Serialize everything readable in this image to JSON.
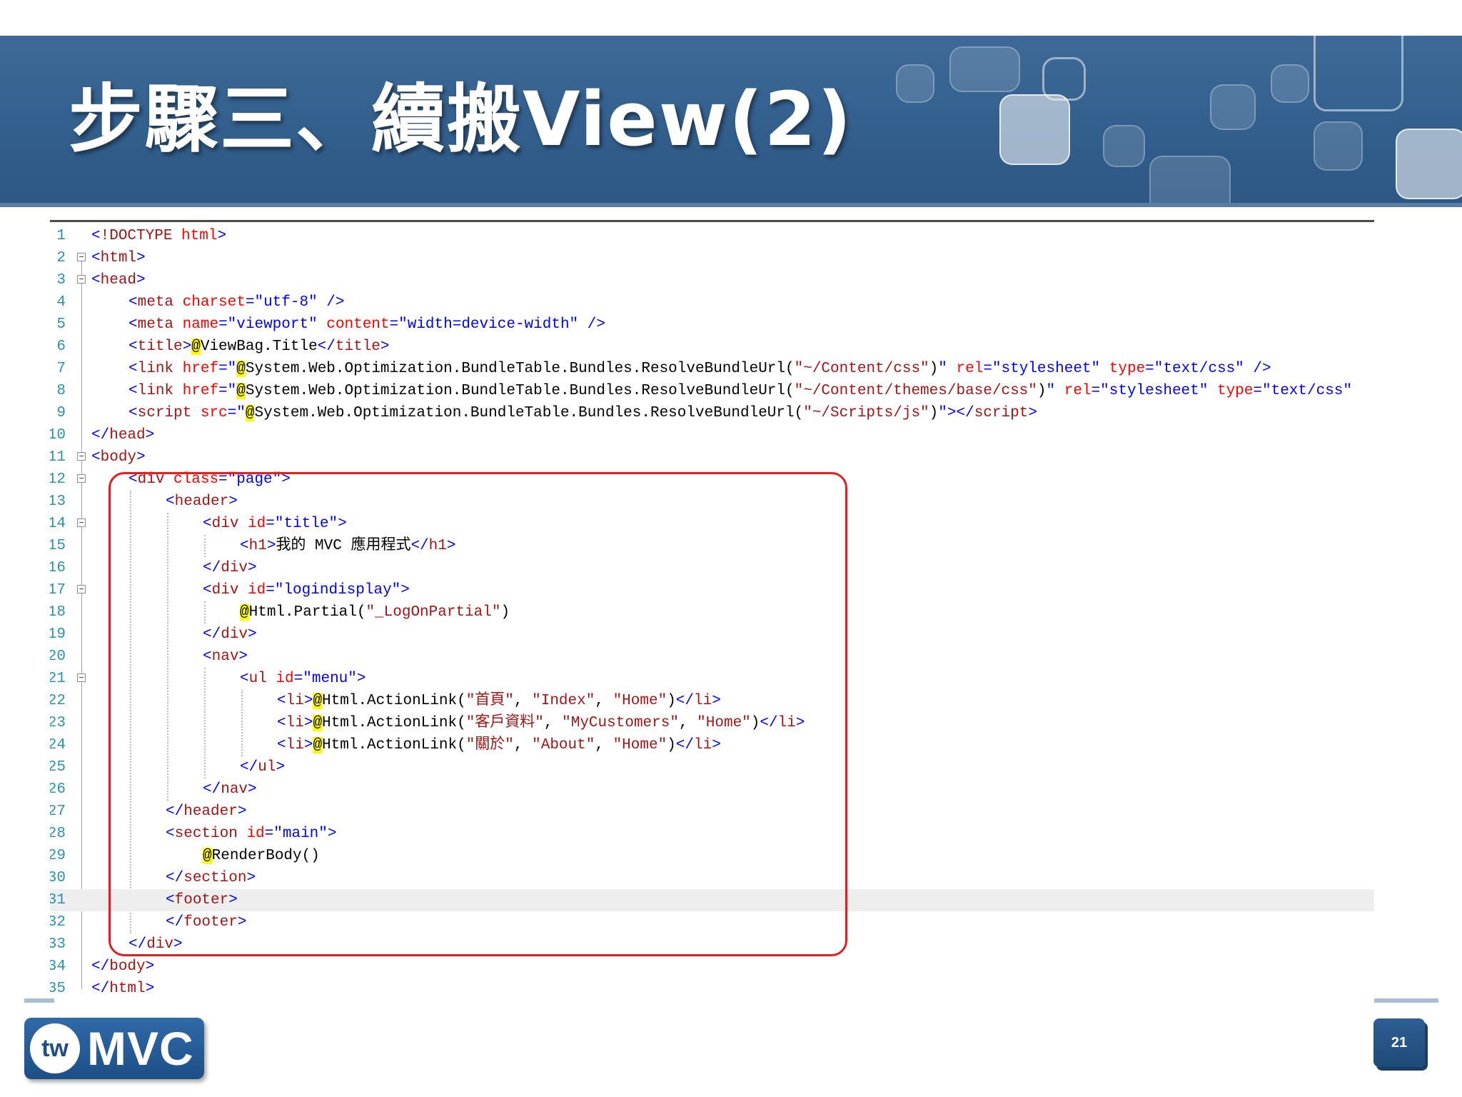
{
  "slide": {
    "title": "步驟三、續搬View(2)",
    "page_number": "21"
  },
  "logo": {
    "badge": "tw",
    "text": "MVC"
  },
  "colors": {
    "banner": "#34618f",
    "highlight_box": "#e02020",
    "tag": "#a31515",
    "attribute": "#ff0000",
    "string": "#0000ff",
    "razor": "#ffff00"
  },
  "code": {
    "lines": [
      {
        "num": "1",
        "fold": "",
        "indent": 0,
        "tokens": [
          [
            "b",
            "<"
          ],
          [
            "m",
            "!DOCTYPE"
          ],
          [
            "t",
            " "
          ],
          [
            "r",
            "html"
          ],
          [
            "b",
            ">"
          ]
        ]
      },
      {
        "num": "2",
        "fold": "minus",
        "indent": 0,
        "tokens": [
          [
            "b",
            "<"
          ],
          [
            "m",
            "html"
          ],
          [
            "b",
            ">"
          ]
        ]
      },
      {
        "num": "3",
        "fold": "minus",
        "indent": 0,
        "tokens": [
          [
            "b",
            "<"
          ],
          [
            "m",
            "head"
          ],
          [
            "b",
            ">"
          ]
        ]
      },
      {
        "num": "4",
        "fold": "",
        "indent": 1,
        "tokens": [
          [
            "b",
            "<"
          ],
          [
            "m",
            "meta"
          ],
          [
            "t",
            " "
          ],
          [
            "r",
            "charset"
          ],
          [
            "b",
            "=\"utf-8\" />"
          ]
        ]
      },
      {
        "num": "5",
        "fold": "",
        "indent": 1,
        "tokens": [
          [
            "b",
            "<"
          ],
          [
            "m",
            "meta"
          ],
          [
            "t",
            " "
          ],
          [
            "r",
            "name"
          ],
          [
            "b",
            "=\"viewport\" "
          ],
          [
            "r",
            "content"
          ],
          [
            "b",
            "=\"width=device-width\" />"
          ]
        ]
      },
      {
        "num": "6",
        "fold": "",
        "indent": 1,
        "tokens": [
          [
            "b",
            "<"
          ],
          [
            "m",
            "title"
          ],
          [
            "b",
            ">"
          ],
          [
            "y",
            "@"
          ],
          [
            "k",
            "ViewBag.Title"
          ],
          [
            "b",
            "</"
          ],
          [
            "m",
            "title"
          ],
          [
            "b",
            ">"
          ]
        ]
      },
      {
        "num": "7",
        "fold": "",
        "indent": 1,
        "tokens": [
          [
            "b",
            "<"
          ],
          [
            "m",
            "link"
          ],
          [
            "t",
            " "
          ],
          [
            "r",
            "href"
          ],
          [
            "b",
            "=\""
          ],
          [
            "y",
            "@"
          ],
          [
            "k",
            "System.Web.Optimization.BundleTable.Bundles.ResolveBundleUrl("
          ],
          [
            "m",
            "\"~/Content/css\""
          ],
          [
            "k",
            ")"
          ],
          [
            "b",
            "\" "
          ],
          [
            "r",
            "rel"
          ],
          [
            "b",
            "=\"stylesheet\" "
          ],
          [
            "r",
            "type"
          ],
          [
            "b",
            "=\"text/css\" />"
          ]
        ]
      },
      {
        "num": "8",
        "fold": "",
        "indent": 1,
        "tokens": [
          [
            "b",
            "<"
          ],
          [
            "m",
            "link"
          ],
          [
            "t",
            " "
          ],
          [
            "r",
            "href"
          ],
          [
            "b",
            "=\""
          ],
          [
            "y",
            "@"
          ],
          [
            "k",
            "System.Web.Optimization.BundleTable.Bundles.ResolveBundleUrl("
          ],
          [
            "m",
            "\"~/Content/themes/base/css\""
          ],
          [
            "k",
            ")"
          ],
          [
            "b",
            "\" "
          ],
          [
            "r",
            "rel"
          ],
          [
            "b",
            "=\"stylesheet\" "
          ],
          [
            "r",
            "type"
          ],
          [
            "b",
            "=\"text/css\""
          ]
        ]
      },
      {
        "num": "9",
        "fold": "",
        "indent": 1,
        "tokens": [
          [
            "b",
            "<"
          ],
          [
            "m",
            "script"
          ],
          [
            "t",
            " "
          ],
          [
            "r",
            "src"
          ],
          [
            "b",
            "=\""
          ],
          [
            "y",
            "@"
          ],
          [
            "k",
            "System.Web.Optimization.BundleTable.Bundles.ResolveBundleUrl("
          ],
          [
            "m",
            "\"~/Scripts/js\""
          ],
          [
            "k",
            ")"
          ],
          [
            "b",
            "\"></"
          ],
          [
            "m",
            "script"
          ],
          [
            "b",
            ">"
          ]
        ]
      },
      {
        "num": "10",
        "fold": "",
        "indent": 0,
        "tokens": [
          [
            "b",
            "</"
          ],
          [
            "m",
            "head"
          ],
          [
            "b",
            ">"
          ]
        ]
      },
      {
        "num": "11",
        "fold": "minus",
        "indent": 0,
        "tokens": [
          [
            "b",
            "<"
          ],
          [
            "m",
            "body"
          ],
          [
            "b",
            ">"
          ]
        ]
      },
      {
        "num": "12",
        "fold": "minus",
        "indent": 1,
        "tokens": [
          [
            "b",
            "<"
          ],
          [
            "m",
            "div"
          ],
          [
            "t",
            " "
          ],
          [
            "r",
            "class"
          ],
          [
            "b",
            "=\"page\">"
          ]
        ]
      },
      {
        "num": "13",
        "fold": "",
        "indent": 2,
        "tokens": [
          [
            "b",
            "<"
          ],
          [
            "m",
            "header"
          ],
          [
            "b",
            ">"
          ]
        ]
      },
      {
        "num": "14",
        "fold": "minus",
        "indent": 3,
        "tokens": [
          [
            "b",
            "<"
          ],
          [
            "m",
            "div"
          ],
          [
            "t",
            " "
          ],
          [
            "r",
            "id"
          ],
          [
            "b",
            "=\"title\">"
          ]
        ]
      },
      {
        "num": "15",
        "fold": "",
        "indent": 4,
        "tokens": [
          [
            "b",
            "<"
          ],
          [
            "m",
            "h1"
          ],
          [
            "b",
            ">"
          ],
          [
            "k",
            "我的 MVC 應用程式"
          ],
          [
            "b",
            "</"
          ],
          [
            "m",
            "h1"
          ],
          [
            "b",
            ">"
          ]
        ]
      },
      {
        "num": "16",
        "fold": "",
        "indent": 3,
        "tokens": [
          [
            "b",
            "</"
          ],
          [
            "m",
            "div"
          ],
          [
            "b",
            ">"
          ]
        ]
      },
      {
        "num": "17",
        "fold": "minus",
        "indent": 3,
        "tokens": [
          [
            "b",
            "<"
          ],
          [
            "m",
            "div"
          ],
          [
            "t",
            " "
          ],
          [
            "r",
            "id"
          ],
          [
            "b",
            "=\"logindisplay\">"
          ]
        ]
      },
      {
        "num": "18",
        "fold": "",
        "indent": 4,
        "tokens": [
          [
            "y",
            "@"
          ],
          [
            "k",
            "Html.Partial("
          ],
          [
            "m",
            "\"_LogOnPartial\""
          ],
          [
            "k",
            ")"
          ]
        ]
      },
      {
        "num": "19",
        "fold": "",
        "indent": 3,
        "tokens": [
          [
            "b",
            "</"
          ],
          [
            "m",
            "div"
          ],
          [
            "b",
            ">"
          ]
        ]
      },
      {
        "num": "20",
        "fold": "",
        "indent": 3,
        "tokens": [
          [
            "b",
            "<"
          ],
          [
            "m",
            "nav"
          ],
          [
            "b",
            ">"
          ]
        ]
      },
      {
        "num": "21",
        "fold": "minus",
        "indent": 4,
        "tokens": [
          [
            "b",
            "<"
          ],
          [
            "m",
            "ul"
          ],
          [
            "t",
            " "
          ],
          [
            "r",
            "id"
          ],
          [
            "b",
            "=\"menu\">"
          ]
        ]
      },
      {
        "num": "22",
        "fold": "",
        "indent": 5,
        "tokens": [
          [
            "b",
            "<"
          ],
          [
            "m",
            "li"
          ],
          [
            "b",
            ">"
          ],
          [
            "y",
            "@"
          ],
          [
            "k",
            "Html.ActionLink("
          ],
          [
            "m",
            "\"首頁\""
          ],
          [
            "k",
            ", "
          ],
          [
            "m",
            "\"Index\""
          ],
          [
            "k",
            ", "
          ],
          [
            "m",
            "\"Home\""
          ],
          [
            "k",
            ")"
          ],
          [
            "b",
            "</"
          ],
          [
            "m",
            "li"
          ],
          [
            "b",
            ">"
          ]
        ]
      },
      {
        "num": "23",
        "fold": "",
        "indent": 5,
        "tokens": [
          [
            "b",
            "<"
          ],
          [
            "m",
            "li"
          ],
          [
            "b",
            ">"
          ],
          [
            "y",
            "@"
          ],
          [
            "k",
            "Html.ActionLink("
          ],
          [
            "m",
            "\"客戶資料\""
          ],
          [
            "k",
            ", "
          ],
          [
            "m",
            "\"MyCustomers\""
          ],
          [
            "k",
            ", "
          ],
          [
            "m",
            "\"Home\""
          ],
          [
            "k",
            ")"
          ],
          [
            "b",
            "</"
          ],
          [
            "m",
            "li"
          ],
          [
            "b",
            ">"
          ]
        ]
      },
      {
        "num": "24",
        "fold": "",
        "indent": 5,
        "tokens": [
          [
            "b",
            "<"
          ],
          [
            "m",
            "li"
          ],
          [
            "b",
            ">"
          ],
          [
            "y",
            "@"
          ],
          [
            "k",
            "Html.ActionLink("
          ],
          [
            "m",
            "\"關於\""
          ],
          [
            "k",
            ", "
          ],
          [
            "m",
            "\"About\""
          ],
          [
            "k",
            ", "
          ],
          [
            "m",
            "\"Home\""
          ],
          [
            "k",
            ")"
          ],
          [
            "b",
            "</"
          ],
          [
            "m",
            "li"
          ],
          [
            "b",
            ">"
          ]
        ]
      },
      {
        "num": "25",
        "fold": "",
        "indent": 4,
        "tokens": [
          [
            "b",
            "</"
          ],
          [
            "m",
            "ul"
          ],
          [
            "b",
            ">"
          ]
        ]
      },
      {
        "num": "26",
        "fold": "",
        "indent": 3,
        "tokens": [
          [
            "b",
            "</"
          ],
          [
            "m",
            "nav"
          ],
          [
            "b",
            ">"
          ]
        ]
      },
      {
        "num": "27",
        "fold": "",
        "indent": 2,
        "tokens": [
          [
            "b",
            "</"
          ],
          [
            "m",
            "header"
          ],
          [
            "b",
            ">"
          ]
        ]
      },
      {
        "num": "28",
        "fold": "",
        "indent": 2,
        "tokens": [
          [
            "b",
            "<"
          ],
          [
            "m",
            "section"
          ],
          [
            "t",
            " "
          ],
          [
            "r",
            "id"
          ],
          [
            "b",
            "=\"main\">"
          ]
        ]
      },
      {
        "num": "29",
        "fold": "",
        "indent": 3,
        "tokens": [
          [
            "y",
            "@"
          ],
          [
            "k",
            "RenderBody()"
          ]
        ]
      },
      {
        "num": "30",
        "fold": "",
        "indent": 2,
        "tokens": [
          [
            "b",
            "</"
          ],
          [
            "m",
            "section"
          ],
          [
            "b",
            ">"
          ]
        ]
      },
      {
        "num": "31",
        "fold": "",
        "indent": 2,
        "highlight": true,
        "tokens": [
          [
            "b",
            "<"
          ],
          [
            "m",
            "footer"
          ],
          [
            "b",
            ">"
          ]
        ]
      },
      {
        "num": "32",
        "fold": "",
        "indent": 2,
        "tokens": [
          [
            "b",
            "</"
          ],
          [
            "m",
            "footer"
          ],
          [
            "b",
            ">"
          ]
        ]
      },
      {
        "num": "33",
        "fold": "",
        "indent": 1,
        "tokens": [
          [
            "b",
            "</"
          ],
          [
            "m",
            "div"
          ],
          [
            "b",
            ">"
          ]
        ]
      },
      {
        "num": "34",
        "fold": "",
        "indent": 0,
        "tokens": [
          [
            "b",
            "</"
          ],
          [
            "m",
            "body"
          ],
          [
            "b",
            ">"
          ]
        ]
      },
      {
        "num": "35",
        "fold": "",
        "indent": 0,
        "tokens": [
          [
            "b",
            "</"
          ],
          [
            "m",
            "html"
          ],
          [
            "b",
            ">"
          ]
        ]
      }
    ]
  }
}
